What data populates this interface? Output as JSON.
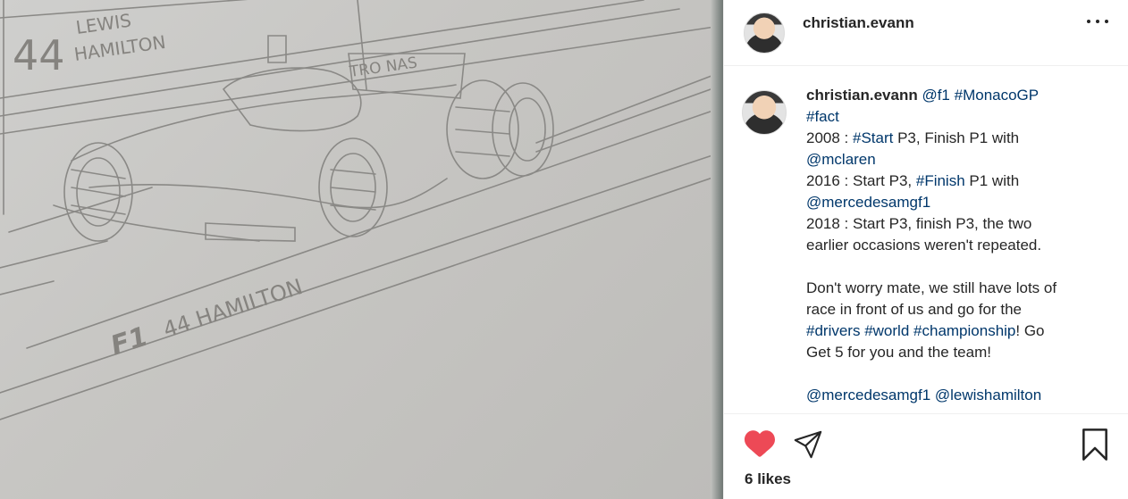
{
  "post": {
    "image_description_icon": "pencil-drawing-f1-car",
    "drawing_text": {
      "number_top": "44",
      "name_top_line1": "LEWIS",
      "name_top_line2": "HAMILTON",
      "sponsor": "TRO NAS",
      "bottom_label": "44 HAMILTON",
      "bottom_logo": "F1"
    }
  },
  "header": {
    "username": "christian.evann",
    "more_icon": "more-horizontal-icon"
  },
  "caption": {
    "username": "christian.evann",
    "mention_f1": "@f1",
    "tag_monaco": "#MonacoGP",
    "tag_fact": "#fact",
    "l2008_pre": "2008 : ",
    "l2008_tag": "#Start",
    "l2008_post": " P3, Finish P1 with",
    "mention_mclaren": "@mclaren",
    "l2016_pre": "2016 : Start P3, ",
    "l2016_tag": "#Finish",
    "l2016_post": " P1 with",
    "mention_mercedes": "@mercedesamgf1",
    "l2018_a": "2018 : Start P3, finish P3, the two",
    "l2018_b": "earlier occasions weren't repeated.",
    "p2_a": "Don't worry mate, we still have lots of",
    "p2_b": "race in front of us and go for the",
    "tag_drivers": "#drivers",
    "tag_world": "#world",
    "tag_championship": "#championship",
    "p2_c_post": "! Go",
    "p2_d": "Get 5 for you and the team!",
    "mention_mercedes2": "@mercedesamgf1",
    "mention_lewis": "@lewishamilton"
  },
  "actions": {
    "like_icon": "heart-filled-icon",
    "share_icon": "send-icon",
    "save_icon": "bookmark-icon",
    "like_color": "#ed4956",
    "likes_count": "6",
    "likes_label": "likes"
  }
}
